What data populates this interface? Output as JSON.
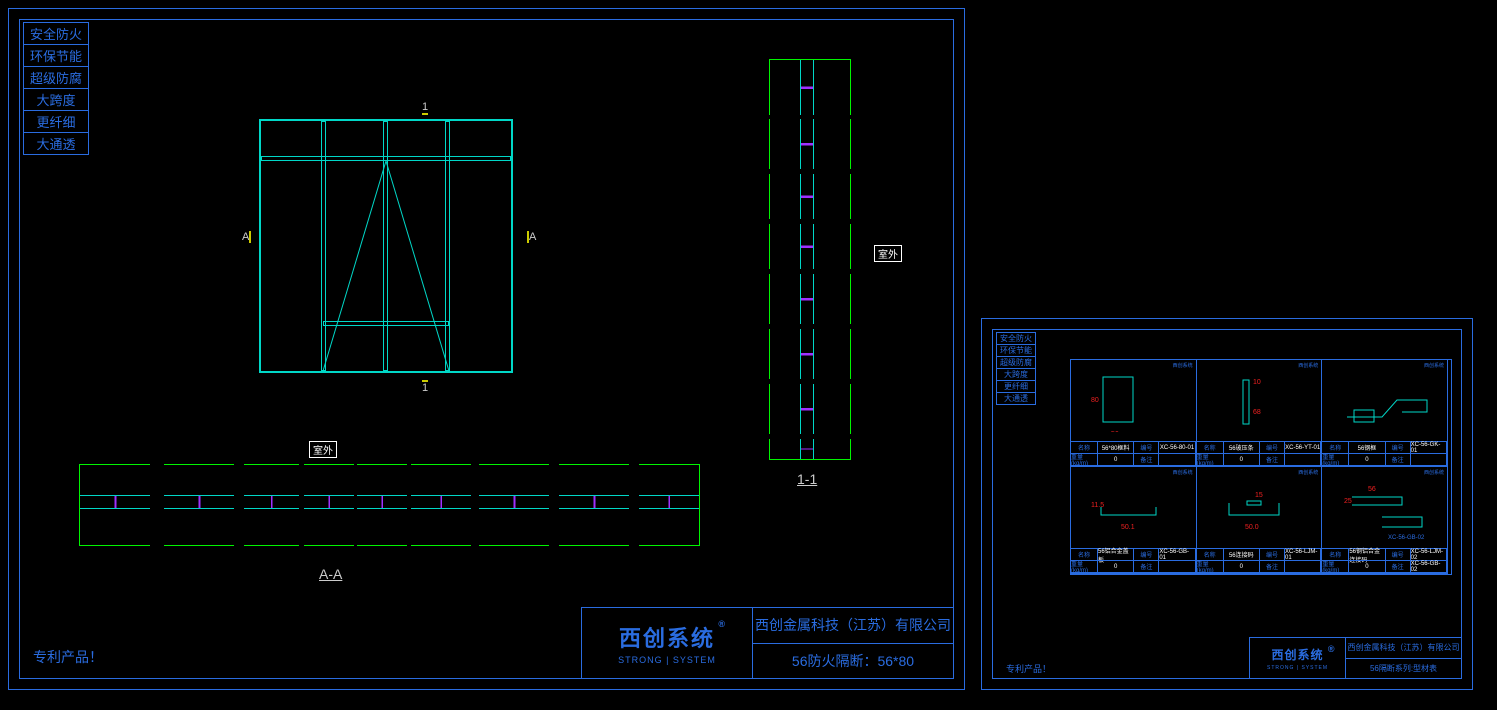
{
  "features": [
    "安全防火",
    "环保节能",
    "超级防腐",
    "大跨度",
    "更纤细",
    "大通透"
  ],
  "patent_note": "专利产品！",
  "brand": {
    "cn": "西创系统",
    "reg": "®",
    "en": "STRONG | SYSTEM"
  },
  "sheet1": {
    "company": "西创金属科技（江苏）有限公司",
    "title": "56防火隔断：56*80",
    "section_aa": "A-A",
    "section_11": "1-1",
    "mark_a_left": "A",
    "mark_a_right": "A",
    "mark_1_top": "1",
    "mark_1_bot": "1",
    "outdoor": "室外"
  },
  "sheet2": {
    "company": "西创金属科技（江苏）有限公司",
    "title": "56隔断系列:型材表",
    "hdr_name": "名称",
    "hdr_code": "编号",
    "hdr_wt": "重量(kg/m)",
    "hdr_note": "备注",
    "profiles": [
      {
        "name": "56*80框料",
        "code": "XC-56-80-01",
        "wt": "0",
        "d1": "80",
        "d2": "56"
      },
      {
        "name": "56玻压条",
        "code": "XC-56-YT-01",
        "wt": "0",
        "d1": "10",
        "d2": "68"
      },
      {
        "name": "56钢框",
        "code": "XC-56-GK-01",
        "wt": "0"
      },
      {
        "name": "56铝合金盖板",
        "code": "XC-56-GB-01",
        "wt": "0",
        "d1": "11.5",
        "d2": "50.1"
      },
      {
        "name": "56连接码",
        "code": "XC-56-LJM-01",
        "wt": "0",
        "d1": "15",
        "d2": "50.0"
      },
      {
        "name": "56钢铝合金连接码",
        "code": "XC-56-LJM-02",
        "wt": "0",
        "d1": "56",
        "d2": "25",
        "code2": "XC-56-GB-02"
      }
    ]
  }
}
